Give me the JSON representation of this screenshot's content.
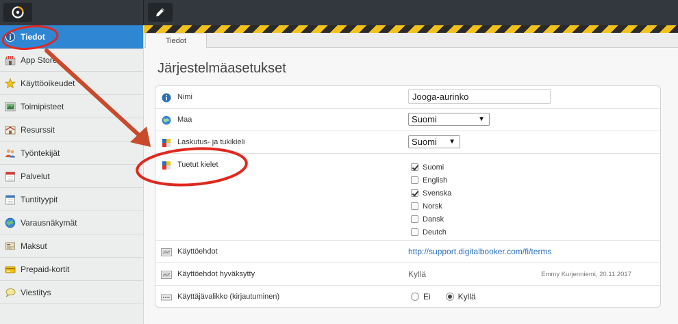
{
  "topbar": {
    "logo_icon": "logo-icon",
    "edit_icon": "pencil-icon"
  },
  "sidebar": {
    "items": [
      {
        "label": "Tiedot",
        "icon": "info-icon",
        "active": true
      },
      {
        "label": "App Store",
        "icon": "store-icon"
      },
      {
        "label": "Käyttöoikeudet",
        "icon": "star-icon"
      },
      {
        "label": "Toimipisteet",
        "icon": "map-icon"
      },
      {
        "label": "Resurssit",
        "icon": "resource-icon"
      },
      {
        "label": "Työntekijät",
        "icon": "people-icon"
      },
      {
        "label": "Palvelut",
        "icon": "calendar-icon"
      },
      {
        "label": "Tuntityypit",
        "icon": "calendar-hours-icon"
      },
      {
        "label": "Varausnäkymät",
        "icon": "globe-icon"
      },
      {
        "label": "Maksut",
        "icon": "payment-icon"
      },
      {
        "label": "Prepaid-kortit",
        "icon": "card-icon"
      },
      {
        "label": "Viestitys",
        "icon": "message-icon"
      }
    ]
  },
  "tabs": [
    {
      "label": "Tiedot"
    }
  ],
  "page": {
    "title": "Järjestelmäasetukset"
  },
  "settings": {
    "name": {
      "label": "Nimi",
      "value": "Jooga-aurinko"
    },
    "country": {
      "label": "Maa",
      "value": "Suomi"
    },
    "billing_language": {
      "label": "Laskutus- ja tukikieli",
      "value": "Suomi"
    },
    "languages": {
      "label": "Tuetut kielet",
      "options": [
        {
          "label": "Suomi",
          "checked": true
        },
        {
          "label": "English",
          "checked": false
        },
        {
          "label": "Svenska",
          "checked": true
        },
        {
          "label": "Norsk",
          "checked": false
        },
        {
          "label": "Dansk",
          "checked": false
        },
        {
          "label": "Deutch",
          "checked": false
        }
      ]
    },
    "terms": {
      "label": "Käyttöehdot",
      "url": "http://support.digitalbooker.com/fi/terms"
    },
    "terms_accepted": {
      "label": "Käyttöehdot hyväksytty",
      "value": "Kyllä",
      "meta": "Emmy Kurjenniemi, 20.11.2017"
    },
    "user_menu": {
      "label": "Käyttäjävalikko (kirjautuminen)",
      "options": [
        {
          "label": "Ei",
          "selected": false
        },
        {
          "label": "Kyllä",
          "selected": true
        }
      ]
    }
  },
  "colors": {
    "accent": "#2f86d3",
    "annotation": "#e0281e",
    "hazard_yellow": "#f2c21a"
  }
}
